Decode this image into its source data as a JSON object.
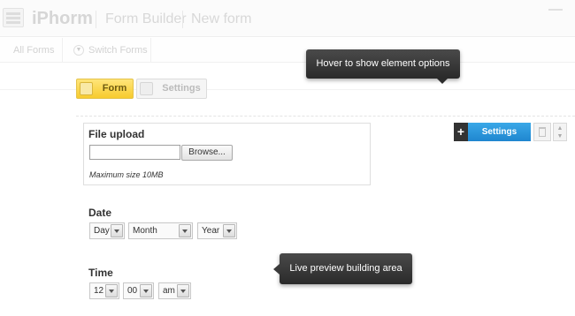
{
  "header": {
    "brand": "iPhorm",
    "section": "Form Builder",
    "form_name": "New form"
  },
  "subnav": {
    "all_forms": "All Forms",
    "switch_forms": "Switch Forms"
  },
  "tabs": [
    {
      "label": "Form",
      "active": true
    },
    {
      "label": "Settings",
      "active": false
    }
  ],
  "tooltips": {
    "hover": "Hover to show element options",
    "preview": "Live preview building area"
  },
  "element_options": {
    "settings_label": "Settings",
    "accent_color": "#2a97dc"
  },
  "file_upload": {
    "label": "File upload",
    "browse_label": "Browse...",
    "description": "Maximum size 10MB"
  },
  "date": {
    "label": "Date",
    "day": "Day",
    "month": "Month",
    "year": "Year"
  },
  "time": {
    "label": "Time",
    "hour": "12",
    "minute": "00",
    "ampm": "am"
  },
  "colors": {
    "active_tab": "#f7cb2d",
    "tooltip_bg": "#333333"
  }
}
